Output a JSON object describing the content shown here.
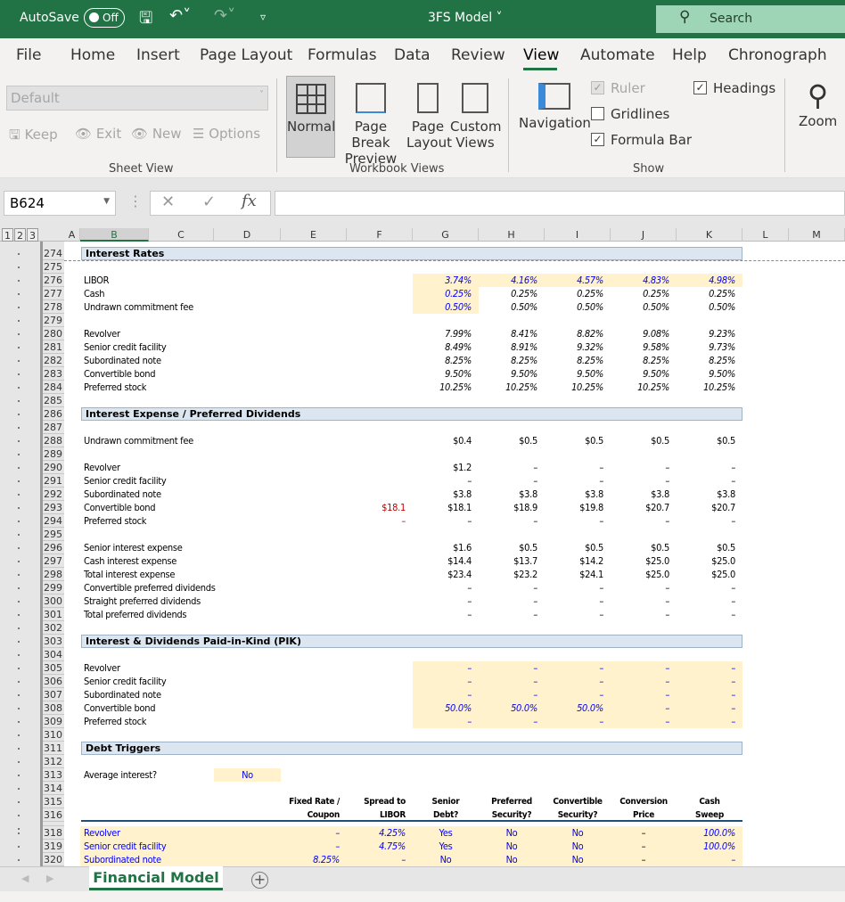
{
  "titlebar": {
    "autosave_label": "AutoSave",
    "autosave_state": "Off",
    "doc_title": "3FS Model ˅",
    "search_placeholder": "Search"
  },
  "menu_tabs": [
    "File",
    "Home",
    "Insert",
    "Page Layout",
    "Formulas",
    "Data",
    "Review",
    "View",
    "Automate",
    "Help",
    "Chronograph"
  ],
  "active_tab": "View",
  "ribbon": {
    "sheet_view": {
      "dropdown": "Default",
      "keep": "Keep",
      "exit": "Exit",
      "new": "New",
      "options": "Options",
      "group": "Sheet View"
    },
    "workbook_views": {
      "normal": "Normal",
      "page_break_1": "Page Break",
      "page_break_2": "Preview",
      "page_layout_1": "Page",
      "page_layout_2": "Layout",
      "custom_1": "Custom",
      "custom_2": "Views",
      "group": "Workbook Views"
    },
    "show": {
      "navigation": "Navigation",
      "ruler": "Ruler",
      "ruler_checked": true,
      "gridlines": "Gridlines",
      "gridlines_checked": false,
      "formula_bar": "Formula Bar",
      "formula_bar_checked": true,
      "headings": "Headings",
      "headings_checked": true,
      "group": "Show"
    },
    "zoom": "Zoom"
  },
  "formula_bar": {
    "name_box": "B624",
    "fx": "fx",
    "formula": ""
  },
  "outline_levels": [
    "1",
    "2",
    "3"
  ],
  "columns": [
    "A",
    "B",
    "C",
    "D",
    "E",
    "F",
    "G",
    "H",
    "I",
    "J",
    "K",
    "L",
    "M"
  ],
  "sheet": {
    "sections": {
      "274": "Interest Rates",
      "286": "Interest Expense / Preferred Dividends",
      "303": "Interest & Dividends Paid-in-Kind (PIK)",
      "311": "Debt Triggers"
    },
    "rows": [
      {
        "r": 276,
        "label": "LIBOR",
        "vals": [
          "",
          "3.74%",
          "4.16%",
          "4.57%",
          "4.83%",
          "4.98%"
        ],
        "cls": "it blue"
      },
      {
        "r": 277,
        "label": "Cash",
        "vals": [
          "",
          "0.25%",
          "0.25%",
          "0.25%",
          "0.25%",
          "0.25%"
        ],
        "cls": "it",
        "first_blue": true
      },
      {
        "r": 278,
        "label": "Undrawn commitment fee",
        "vals": [
          "",
          "0.50%",
          "0.50%",
          "0.50%",
          "0.50%",
          "0.50%"
        ],
        "cls": "it",
        "first_blue": true
      },
      {
        "r": 280,
        "label": "Revolver",
        "vals": [
          "",
          "7.99%",
          "8.41%",
          "8.82%",
          "9.08%",
          "9.23%"
        ],
        "cls": "it"
      },
      {
        "r": 281,
        "label": "Senior credit facility",
        "vals": [
          "",
          "8.49%",
          "8.91%",
          "9.32%",
          "9.58%",
          "9.73%"
        ],
        "cls": "it"
      },
      {
        "r": 282,
        "label": "Subordinated note",
        "vals": [
          "",
          "8.25%",
          "8.25%",
          "8.25%",
          "8.25%",
          "8.25%"
        ],
        "cls": "it"
      },
      {
        "r": 283,
        "label": "Convertible bond",
        "vals": [
          "",
          "9.50%",
          "9.50%",
          "9.50%",
          "9.50%",
          "9.50%"
        ],
        "cls": "it"
      },
      {
        "r": 284,
        "label": "Preferred stock",
        "vals": [
          "",
          "10.25%",
          "10.25%",
          "10.25%",
          "10.25%",
          "10.25%"
        ],
        "cls": "it"
      },
      {
        "r": 288,
        "label": "Undrawn commitment fee",
        "vals": [
          "",
          "$0.4",
          "$0.5",
          "$0.5",
          "$0.5",
          "$0.5"
        ]
      },
      {
        "r": 290,
        "label": "Revolver",
        "vals": [
          "",
          "$1.2",
          "–",
          "–",
          "–",
          "–"
        ]
      },
      {
        "r": 291,
        "label": "Senior credit facility",
        "vals": [
          "",
          "–",
          "–",
          "–",
          "–",
          "–"
        ]
      },
      {
        "r": 292,
        "label": "Subordinated note",
        "vals": [
          "",
          "$3.8",
          "$3.8",
          "$3.8",
          "$3.8",
          "$3.8"
        ]
      },
      {
        "r": 293,
        "label": "Convertible bond",
        "vals": [
          "$18.1",
          "$18.1",
          "$18.9",
          "$19.8",
          "$20.7",
          "$20.7"
        ],
        "f_red": true
      },
      {
        "r": 294,
        "label": "Preferred stock",
        "vals": [
          "–",
          "–",
          "–",
          "–",
          "–",
          "–"
        ],
        "f_red": true
      },
      {
        "r": 296,
        "label": "Senior interest expense",
        "vals": [
          "",
          "$1.6",
          "$0.5",
          "$0.5",
          "$0.5",
          "$0.5"
        ]
      },
      {
        "r": 297,
        "label": "Cash interest expense",
        "vals": [
          "",
          "$14.4",
          "$13.7",
          "$14.2",
          "$25.0",
          "$25.0"
        ]
      },
      {
        "r": 298,
        "label": "Total interest expense",
        "vals": [
          "",
          "$23.4",
          "$23.2",
          "$24.1",
          "$25.0",
          "$25.0"
        ]
      },
      {
        "r": 299,
        "label": "Convertible preferred dividends",
        "vals": [
          "",
          "–",
          "–",
          "–",
          "–",
          "–"
        ]
      },
      {
        "r": 300,
        "label": "Straight preferred dividends",
        "vals": [
          "",
          "–",
          "–",
          "–",
          "–",
          "–"
        ]
      },
      {
        "r": 301,
        "label": "Total preferred dividends",
        "vals": [
          "",
          "–",
          "–",
          "–",
          "–",
          "–"
        ]
      },
      {
        "r": 305,
        "label": "Revolver",
        "vals": [
          "",
          "–",
          "–",
          "–",
          "–",
          "–"
        ],
        "cls": "blue"
      },
      {
        "r": 306,
        "label": "Senior credit facility",
        "vals": [
          "",
          "–",
          "–",
          "–",
          "–",
          "–"
        ],
        "cls": "blue"
      },
      {
        "r": 307,
        "label": "Subordinated note",
        "vals": [
          "",
          "–",
          "–",
          "–",
          "–",
          "–"
        ],
        "cls": "blue"
      },
      {
        "r": 308,
        "label": "Convertible bond",
        "vals": [
          "",
          "50.0%",
          "50.0%",
          "50.0%",
          "–",
          "–"
        ],
        "cls": "blue it"
      },
      {
        "r": 309,
        "label": "Preferred stock",
        "vals": [
          "",
          "–",
          "–",
          "–",
          "–",
          "–"
        ],
        "cls": "blue"
      }
    ],
    "average_interest": {
      "label": "Average interest?",
      "value": "No"
    },
    "trigger_headers": [
      [
        "Fixed Rate /",
        "Coupon"
      ],
      [
        "Spread to",
        "LIBOR"
      ],
      [
        "Senior",
        "Debt?"
      ],
      [
        "Preferred",
        "Security?"
      ],
      [
        "Convertible",
        "Security?"
      ],
      [
        "Conversion",
        "Price"
      ],
      [
        "Cash",
        "Sweep"
      ]
    ],
    "trigger_rows": [
      {
        "r": 318,
        "label": "Revolver",
        "vals": [
          "–",
          "4.25%",
          "Yes",
          "No",
          "No",
          "–",
          "100.0%"
        ]
      },
      {
        "r": 319,
        "label": "Senior credit facility",
        "vals": [
          "–",
          "4.75%",
          "Yes",
          "No",
          "No",
          "–",
          "100.0%"
        ]
      },
      {
        "r": 320,
        "label": "Subordinated note",
        "vals": [
          "8.25%",
          "–",
          "No",
          "No",
          "No",
          "–",
          "–"
        ]
      }
    ]
  },
  "sheet_tab": "Financial Model",
  "colors": {
    "excel_green": "#217346",
    "input_fill": "#fff2cc",
    "input_blue": "#0000ff",
    "section_fill": "#dce6f0",
    "link_red": "#c00000"
  }
}
